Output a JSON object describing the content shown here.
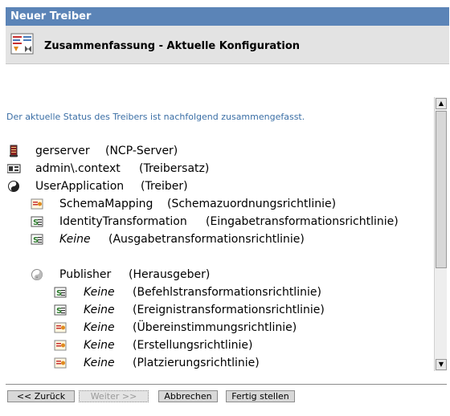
{
  "window": {
    "title": "Neuer Treiber"
  },
  "header": {
    "title": "Zusammenfassung - Aktuelle Konfiguration",
    "icon": "summary-config-icon"
  },
  "intro_text": "Der aktuelle Status des Treibers ist nachfolgend zusammengefasst.",
  "tree": [
    {
      "icon": "server-icon",
      "name": "gerserver",
      "type": "(NCP-Server)"
    },
    {
      "icon": "driverset-icon",
      "name": "admin\\.context",
      "type": "(Treibersatz)"
    },
    {
      "icon": "driver-icon",
      "name": "UserApplication",
      "type": "(Treiber)"
    },
    {
      "icon": "policy-icon",
      "name": "SchemaMapping",
      "type": "(Schemazuordnungsrichtlinie)"
    },
    {
      "icon": "stylesheet-icon",
      "name": "IdentityTransformation",
      "type": "(Eingabetransformationsrichtlinie)"
    },
    {
      "icon": "stylesheet-icon",
      "name": "Keine",
      "type": "(Ausgabetransformationsrichtlinie)"
    },
    {
      "icon": "publisher-icon",
      "name": "Publisher",
      "type": "(Herausgeber)"
    },
    {
      "icon": "stylesheet-icon",
      "name": "Keine",
      "type": "(Befehlstransformationsrichtlinie)"
    },
    {
      "icon": "stylesheet-icon",
      "name": "Keine",
      "type": "(Ereignistransformationsrichtlinie)"
    },
    {
      "icon": "policy-icon",
      "name": "Keine",
      "type": "(Übereinstimmungsrichtlinie)"
    },
    {
      "icon": "policy-icon",
      "name": "Keine",
      "type": "(Erstellungsrichtlinie)"
    },
    {
      "icon": "policy-icon",
      "name": "Keine",
      "type": "(Platzierungsrichtlinie)"
    }
  ],
  "buttons": {
    "back": "<< Zurück",
    "next": "Weiter >>",
    "cancel": "Abbrechen",
    "finish": "Fertig stellen"
  },
  "colors": {
    "titlebar": "#5b84b7",
    "intro_text": "#3a6ea5"
  }
}
